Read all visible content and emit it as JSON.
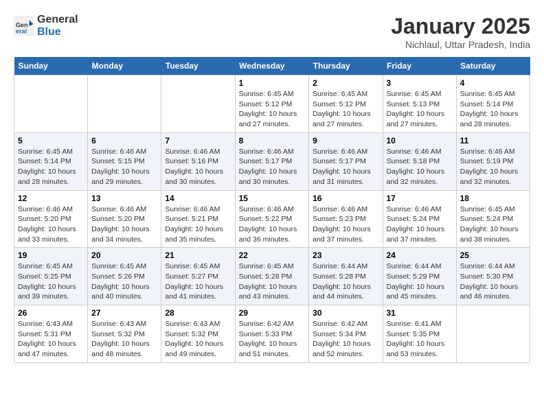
{
  "header": {
    "logo_line1": "General",
    "logo_line2": "Blue",
    "title": "January 2025",
    "subtitle": "Nichlaul, Uttar Pradesh, India"
  },
  "days_of_week": [
    "Sunday",
    "Monday",
    "Tuesday",
    "Wednesday",
    "Thursday",
    "Friday",
    "Saturday"
  ],
  "weeks": [
    [
      {
        "day": "",
        "info": ""
      },
      {
        "day": "",
        "info": ""
      },
      {
        "day": "",
        "info": ""
      },
      {
        "day": "1",
        "info": "Sunrise: 6:45 AM\nSunset: 5:12 PM\nDaylight: 10 hours and 27 minutes."
      },
      {
        "day": "2",
        "info": "Sunrise: 6:45 AM\nSunset: 5:12 PM\nDaylight: 10 hours and 27 minutes."
      },
      {
        "day": "3",
        "info": "Sunrise: 6:45 AM\nSunset: 5:13 PM\nDaylight: 10 hours and 27 minutes."
      },
      {
        "day": "4",
        "info": "Sunrise: 6:45 AM\nSunset: 5:14 PM\nDaylight: 10 hours and 28 minutes."
      }
    ],
    [
      {
        "day": "5",
        "info": "Sunrise: 6:45 AM\nSunset: 5:14 PM\nDaylight: 10 hours and 28 minutes."
      },
      {
        "day": "6",
        "info": "Sunrise: 6:46 AM\nSunset: 5:15 PM\nDaylight: 10 hours and 29 minutes."
      },
      {
        "day": "7",
        "info": "Sunrise: 6:46 AM\nSunset: 5:16 PM\nDaylight: 10 hours and 30 minutes."
      },
      {
        "day": "8",
        "info": "Sunrise: 6:46 AM\nSunset: 5:17 PM\nDaylight: 10 hours and 30 minutes."
      },
      {
        "day": "9",
        "info": "Sunrise: 6:46 AM\nSunset: 5:17 PM\nDaylight: 10 hours and 31 minutes."
      },
      {
        "day": "10",
        "info": "Sunrise: 6:46 AM\nSunset: 5:18 PM\nDaylight: 10 hours and 32 minutes."
      },
      {
        "day": "11",
        "info": "Sunrise: 6:46 AM\nSunset: 5:19 PM\nDaylight: 10 hours and 32 minutes."
      }
    ],
    [
      {
        "day": "12",
        "info": "Sunrise: 6:46 AM\nSunset: 5:20 PM\nDaylight: 10 hours and 33 minutes."
      },
      {
        "day": "13",
        "info": "Sunrise: 6:46 AM\nSunset: 5:20 PM\nDaylight: 10 hours and 34 minutes."
      },
      {
        "day": "14",
        "info": "Sunrise: 6:46 AM\nSunset: 5:21 PM\nDaylight: 10 hours and 35 minutes."
      },
      {
        "day": "15",
        "info": "Sunrise: 6:46 AM\nSunset: 5:22 PM\nDaylight: 10 hours and 36 minutes."
      },
      {
        "day": "16",
        "info": "Sunrise: 6:46 AM\nSunset: 5:23 PM\nDaylight: 10 hours and 37 minutes."
      },
      {
        "day": "17",
        "info": "Sunrise: 6:46 AM\nSunset: 5:24 PM\nDaylight: 10 hours and 37 minutes."
      },
      {
        "day": "18",
        "info": "Sunrise: 6:45 AM\nSunset: 5:24 PM\nDaylight: 10 hours and 38 minutes."
      }
    ],
    [
      {
        "day": "19",
        "info": "Sunrise: 6:45 AM\nSunset: 5:25 PM\nDaylight: 10 hours and 39 minutes."
      },
      {
        "day": "20",
        "info": "Sunrise: 6:45 AM\nSunset: 5:26 PM\nDaylight: 10 hours and 40 minutes."
      },
      {
        "day": "21",
        "info": "Sunrise: 6:45 AM\nSunset: 5:27 PM\nDaylight: 10 hours and 41 minutes."
      },
      {
        "day": "22",
        "info": "Sunrise: 6:45 AM\nSunset: 5:28 PM\nDaylight: 10 hours and 43 minutes."
      },
      {
        "day": "23",
        "info": "Sunrise: 6:44 AM\nSunset: 5:28 PM\nDaylight: 10 hours and 44 minutes."
      },
      {
        "day": "24",
        "info": "Sunrise: 6:44 AM\nSunset: 5:29 PM\nDaylight: 10 hours and 45 minutes."
      },
      {
        "day": "25",
        "info": "Sunrise: 6:44 AM\nSunset: 5:30 PM\nDaylight: 10 hours and 46 minutes."
      }
    ],
    [
      {
        "day": "26",
        "info": "Sunrise: 6:43 AM\nSunset: 5:31 PM\nDaylight: 10 hours and 47 minutes."
      },
      {
        "day": "27",
        "info": "Sunrise: 6:43 AM\nSunset: 5:32 PM\nDaylight: 10 hours and 48 minutes."
      },
      {
        "day": "28",
        "info": "Sunrise: 6:43 AM\nSunset: 5:32 PM\nDaylight: 10 hours and 49 minutes."
      },
      {
        "day": "29",
        "info": "Sunrise: 6:42 AM\nSunset: 5:33 PM\nDaylight: 10 hours and 51 minutes."
      },
      {
        "day": "30",
        "info": "Sunrise: 6:42 AM\nSunset: 5:34 PM\nDaylight: 10 hours and 52 minutes."
      },
      {
        "day": "31",
        "info": "Sunrise: 6:41 AM\nSunset: 5:35 PM\nDaylight: 10 hours and 53 minutes."
      },
      {
        "day": "",
        "info": ""
      }
    ]
  ]
}
